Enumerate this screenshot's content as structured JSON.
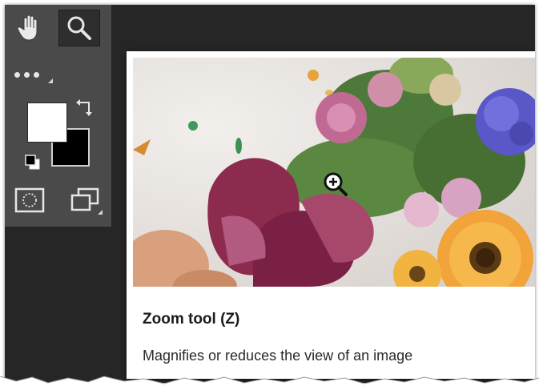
{
  "tools": {
    "hand": {
      "icon": "hand-icon"
    },
    "zoom": {
      "icon": "magnifier-icon",
      "active": true
    },
    "more": {
      "icon": "ellipsis-icon"
    },
    "foreground_color": "#ffffff",
    "background_color": "#000000",
    "swap_icon": "swap-arrows-icon",
    "default_colors_icon": "default-colors-icon",
    "quick_mask_icon": "quick-mask-icon",
    "screen_mode_icon": "screen-mode-icon"
  },
  "tooltip": {
    "title": "Zoom tool (Z)",
    "description": "Magnifies or reduces the view of an image",
    "preview_image": "flower-bouquet-with-zoom-cursor",
    "cursor_icon": "zoom-in-cursor-icon"
  },
  "colors": {
    "toolbar_bg": "#4a4a4a",
    "canvas_bg": "#262626",
    "active_tool_bg": "#2e2e2e"
  }
}
